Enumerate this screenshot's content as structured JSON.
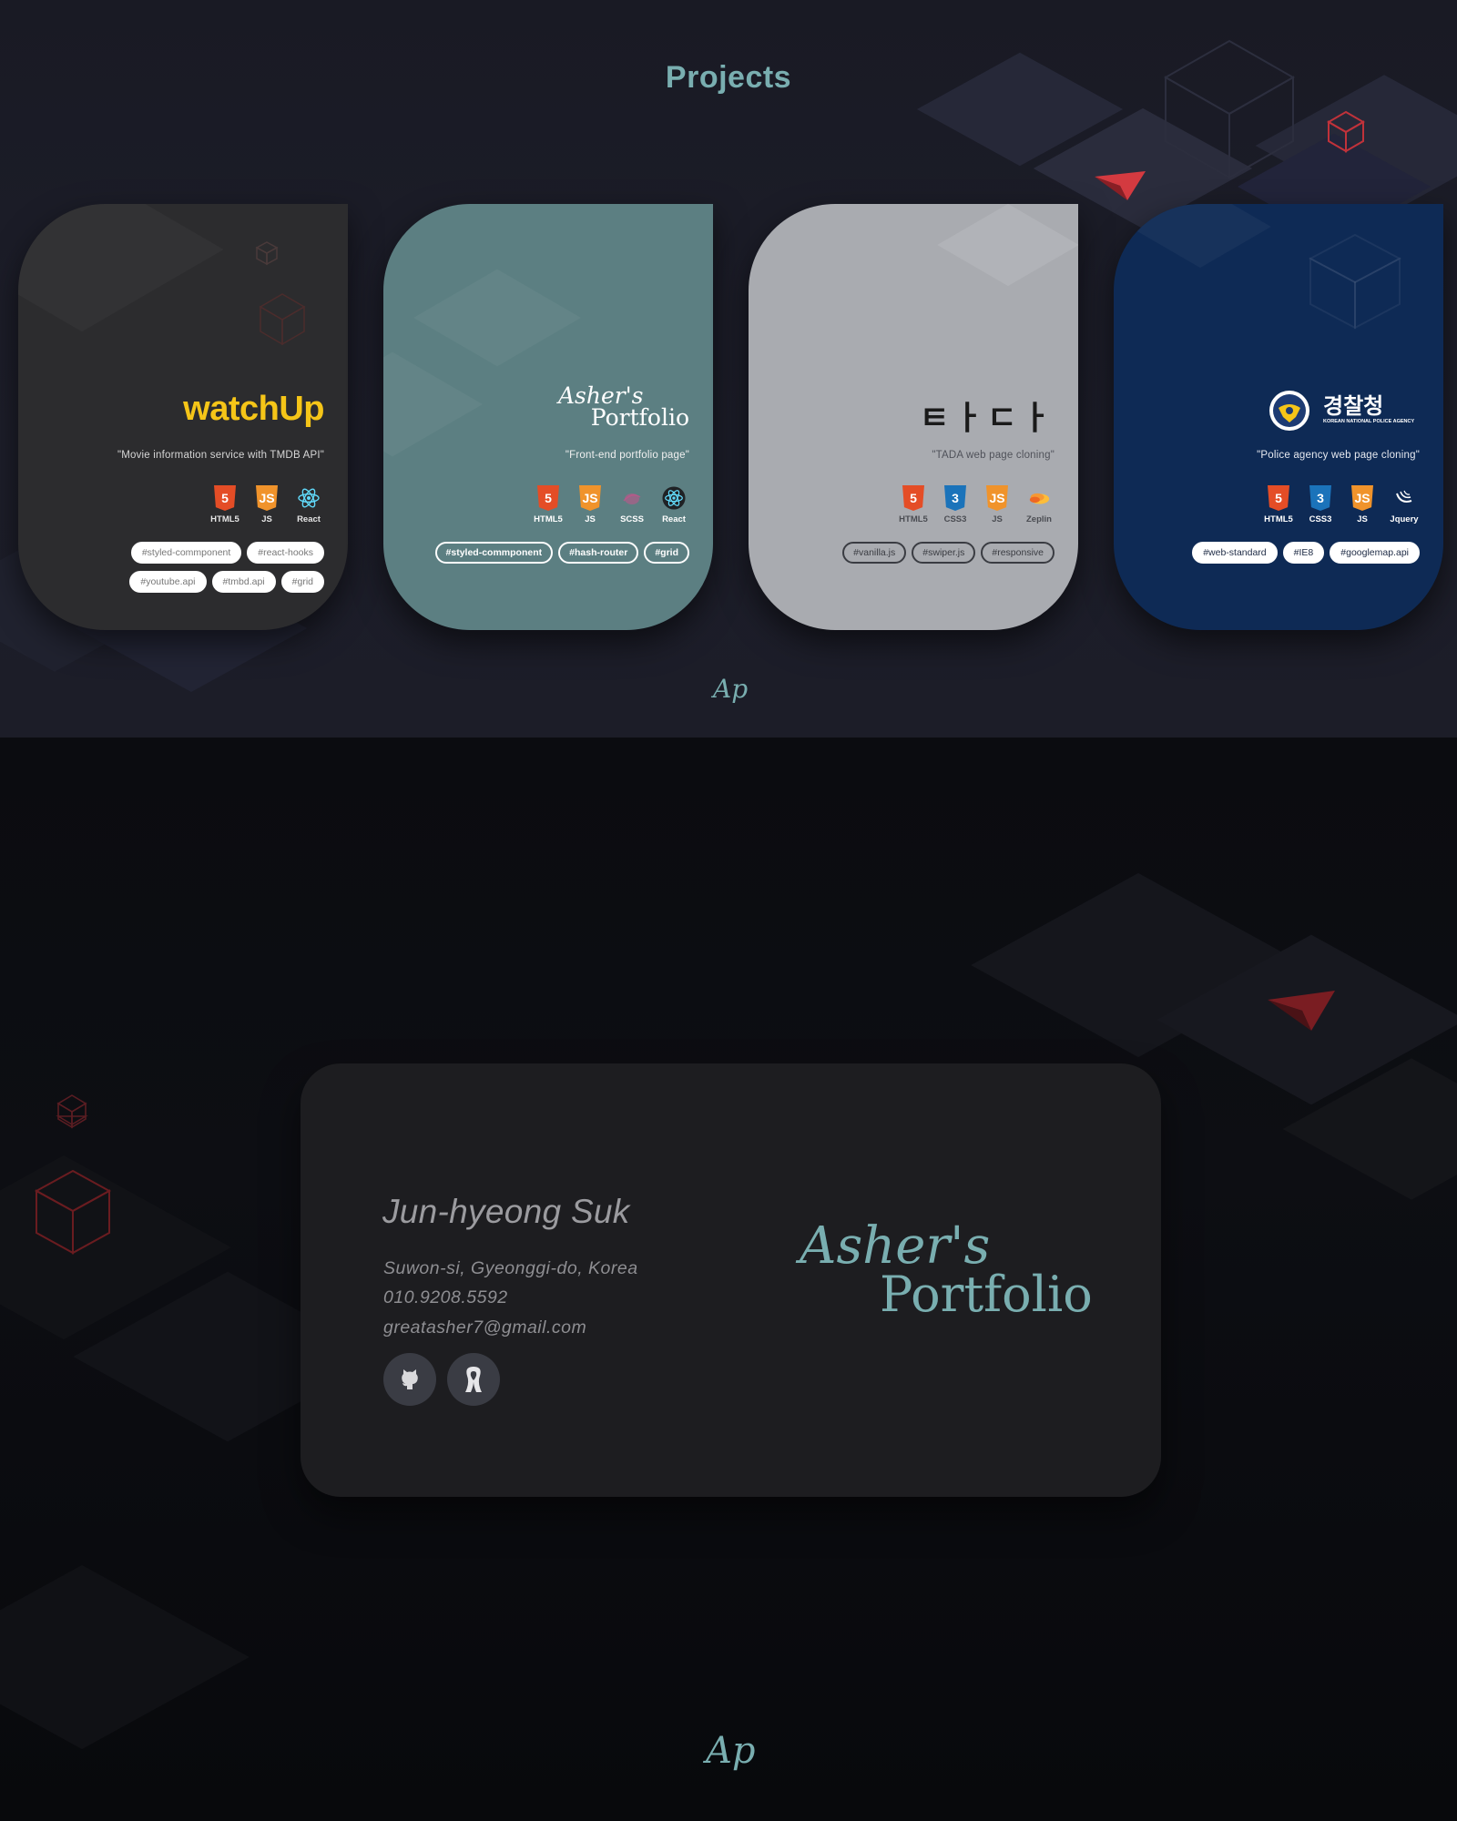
{
  "projects": {
    "title": "Projects",
    "cards": [
      {
        "logo": "watchUp",
        "desc": "\"Movie information service with TMDB API\"",
        "stack": [
          "HTML5",
          "JS",
          "React"
        ],
        "tags": [
          "#styled-commponent",
          "#react-hooks",
          "#youtube.api",
          "#tmbd.api",
          "#grid"
        ]
      },
      {
        "logo_line1": "Asher's",
        "logo_line2": "Portfolio",
        "desc": "\"Front-end portfolio page\"",
        "stack": [
          "HTML5",
          "JS",
          "SCSS",
          "React"
        ],
        "tags": [
          "#styled-commponent",
          "#hash-router",
          "#grid"
        ]
      },
      {
        "logo": "ㅌㅏㄷㅏ",
        "desc": "\"TADA web page cloning\"",
        "stack": [
          "HTML5",
          "CSS3",
          "JS",
          "Zeplin"
        ],
        "tags": [
          "#vanilla.js",
          "#swiper.js",
          "#responsive"
        ]
      },
      {
        "logo": "경찰청",
        "logo_sub": "KOREAN NATIONAL POLICE AGENCY",
        "desc": "\"Police agency web page cloning\"",
        "stack": [
          "HTML5",
          "CSS3",
          "JS",
          "Jquery"
        ],
        "tags": [
          "#web-standard",
          "#IE8",
          "#googlemap.api"
        ]
      }
    ],
    "footer_logo": "Ap"
  },
  "contact": {
    "name": "Jun-hyeong Suk",
    "location": "Suwon-si, Gyeonggi-do, Korea",
    "phone": "010.9208.5592",
    "email": "greatasher7@gmail.com",
    "social": [
      "github-icon",
      "velog-icon"
    ],
    "logo_line1": "Asher's",
    "logo_line2": "Portfolio",
    "footer_logo": "Ap"
  },
  "colors": {
    "accent": "#79aeb0",
    "watchup_yellow": "#f5c518",
    "card1_bg": "#2c2c2e",
    "card2_bg": "#5c7f82",
    "card3_bg": "#a9abb0",
    "card4_bg": "#0e2a55"
  }
}
